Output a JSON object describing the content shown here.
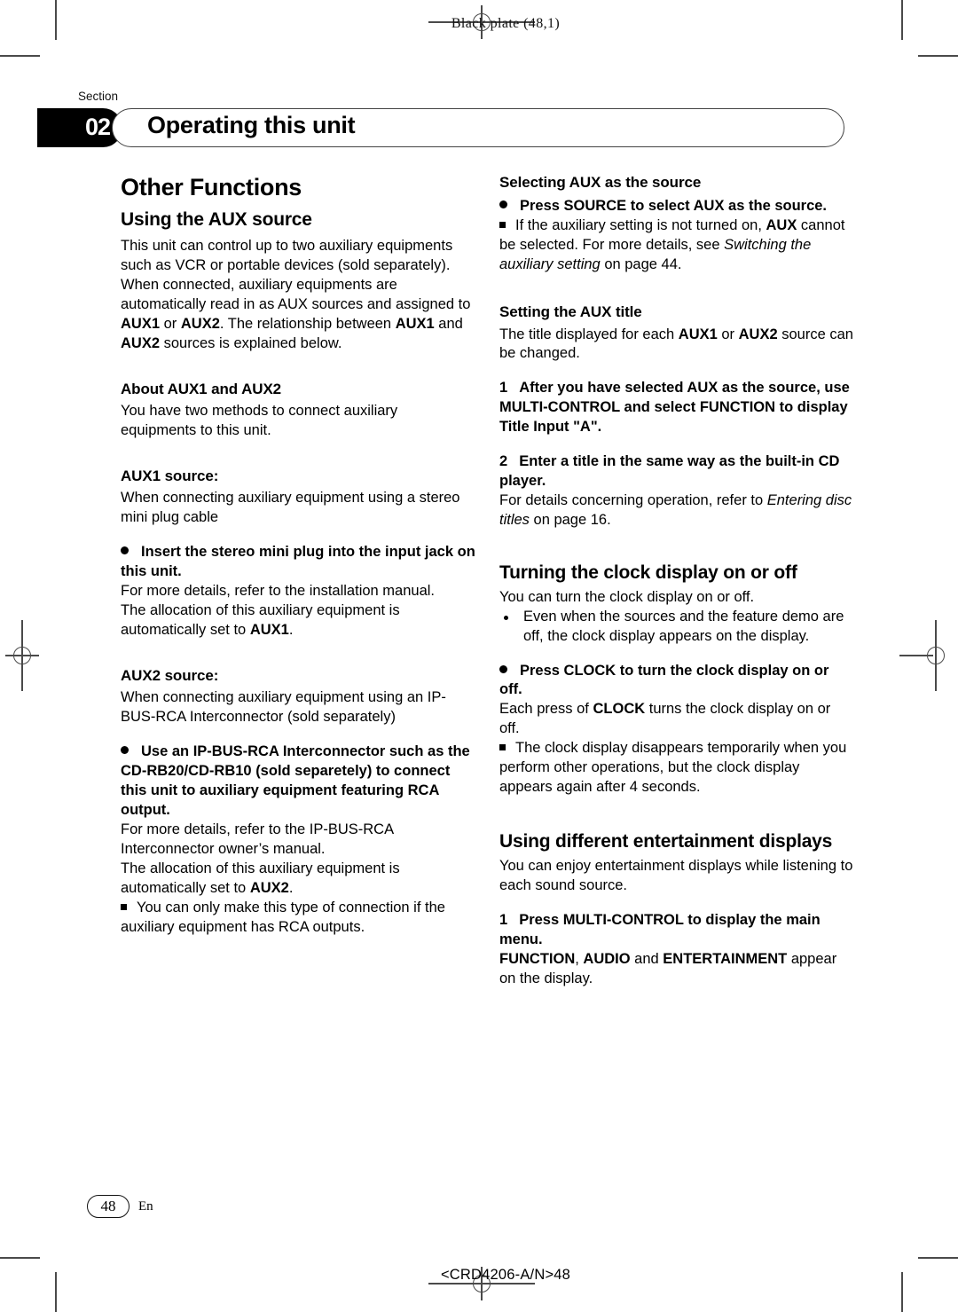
{
  "print_marks": {
    "plate_note": "Black plate (48,1)",
    "doc_id": "<CRD4206-A/N>48"
  },
  "header": {
    "section_label": "Section",
    "chapter_number": "02",
    "chapter_title": "Operating this unit"
  },
  "footer": {
    "page_number": "48",
    "language": "En"
  },
  "left_column": {
    "title": "Other Functions",
    "section_aux": {
      "heading": "Using the AUX source",
      "intro_1": "This unit can control up to two auxiliary equipments such as VCR or portable devices (sold separately). When connected, auxiliary equipments are automatically read in as AUX sources and assigned to ",
      "intro_aux1": "AUX1",
      "intro_or": " or ",
      "intro_aux2": "AUX2",
      "intro_2": ". The relationship between ",
      "intro_aux1b": "AUX1",
      "intro_and": " and ",
      "intro_aux2b": "AUX2",
      "intro_3": " sources is explained below."
    },
    "about": {
      "heading_bold": "About ",
      "heading_aux1": "AUX1",
      "heading_and": " and ",
      "heading_aux2": "AUX2",
      "body": "You have two methods to connect auxiliary equipments to this unit."
    },
    "aux1": {
      "heading_code": "AUX1",
      "heading_rest": " source:",
      "body": "When connecting auxiliary equipment using a stereo mini plug cable",
      "bullet": "Insert the stereo mini plug into the input jack on this unit.",
      "after_1": "For more details, refer to the installation manual.",
      "after_2_pre": "The allocation of this auxiliary equipment is automatically set to ",
      "after_2_code": "AUX1",
      "after_2_post": "."
    },
    "aux2": {
      "heading_code": "AUX2",
      "heading_rest": " source:",
      "body": "When connecting auxiliary equipment using an IP-BUS-RCA Interconnector (sold separately)",
      "bullet": "Use an IP-BUS-RCA Interconnector such as the CD-RB20/CD-RB10 (sold separetely) to connect this unit to auxiliary equipment featuring RCA output.",
      "after_1": "For more details, refer to the IP-BUS-RCA Interconnector owner’s manual.",
      "after_2_pre": "The allocation of this auxiliary equipment is automatically set to ",
      "after_2_code": "AUX2",
      "after_2_post": ".",
      "note": "You can only make this type of connection if the auxiliary equipment has RCA outputs."
    }
  },
  "right_column": {
    "selecting_aux": {
      "heading": "Selecting AUX as the source",
      "bullet": "Press SOURCE to select AUX as the source.",
      "note_pre": "If the auxiliary setting is not turned on, ",
      "note_code": "AUX",
      "note_mid": " cannot be selected. For more details, see ",
      "note_italic": "Switching the auxiliary setting",
      "note_post": " on page 44."
    },
    "setting_title": {
      "heading": "Setting the AUX title",
      "body_pre": "The title displayed for each ",
      "body_code1": "AUX1",
      "body_or": " or ",
      "body_code2": "AUX2",
      "body_post": " source can be changed.",
      "step1_num": "1",
      "step1_text": "After you have selected AUX as the source, use MULTI-CONTROL and select FUNCTION to display Title Input \"A\".",
      "step2_num": "2",
      "step2_text": "Enter a title in the same way as the built-in CD player.",
      "step2_after_pre": "For details concerning operation, refer to ",
      "step2_after_italic": "Entering disc titles",
      "step2_after_post": " on page 16."
    },
    "clock": {
      "heading": "Turning the clock display on or off",
      "body": "You can turn the clock display on or off.",
      "list": [
        "Even when the sources and the feature demo are off, the clock display appears on the display."
      ],
      "bullet": "Press CLOCK to turn the clock display on or off.",
      "after_pre": "Each press of ",
      "after_code": "CLOCK",
      "after_post": " turns the clock display on or off.",
      "note": "The clock display disappears temporarily when you perform other operations, but the clock display appears again after 4 seconds."
    },
    "entertainment": {
      "heading": "Using different entertainment displays",
      "body": "You can enjoy entertainment displays while listening to each sound source.",
      "step1_num": "1",
      "step1_text": "Press MULTI-CONTROL to display the main menu.",
      "after_code1": "FUNCTION",
      "after_sep": ", ",
      "after_code2": "AUDIO",
      "after_and": " and ",
      "after_code3": "ENTERTAINMENT",
      "after_post": " appear on the display."
    }
  }
}
